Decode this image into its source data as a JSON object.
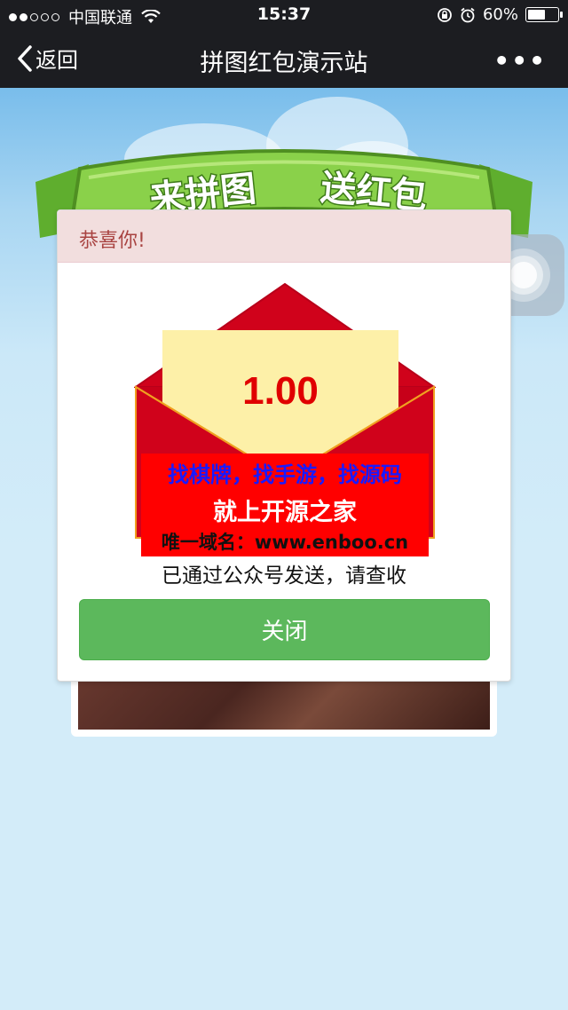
{
  "status_bar": {
    "carrier": "中国联通",
    "time": "15:37",
    "battery_percent": "60%",
    "battery_level": 0.6
  },
  "nav": {
    "back_label": "返回",
    "title": "拼图红包演示站",
    "more_label": "•••"
  },
  "banner": {
    "text_left": "来拼图",
    "text_right": "送红包"
  },
  "modal": {
    "header_title": "恭喜你!",
    "amount": "1.00",
    "ad_line1": "找棋牌，找手游，找源码",
    "ad_line2": "就上开源之家",
    "ad_line3": "唯一域名：www.enboo.cn",
    "sent_text": "已通过公众号发送，请查收",
    "close_label": "关闭"
  },
  "colors": {
    "nav_bg": "#1c1d21",
    "envelope_red": "#d0021b",
    "card_yellow": "#fdf0a8",
    "button_green": "#5cb85c",
    "header_pink": "#f2dede"
  }
}
